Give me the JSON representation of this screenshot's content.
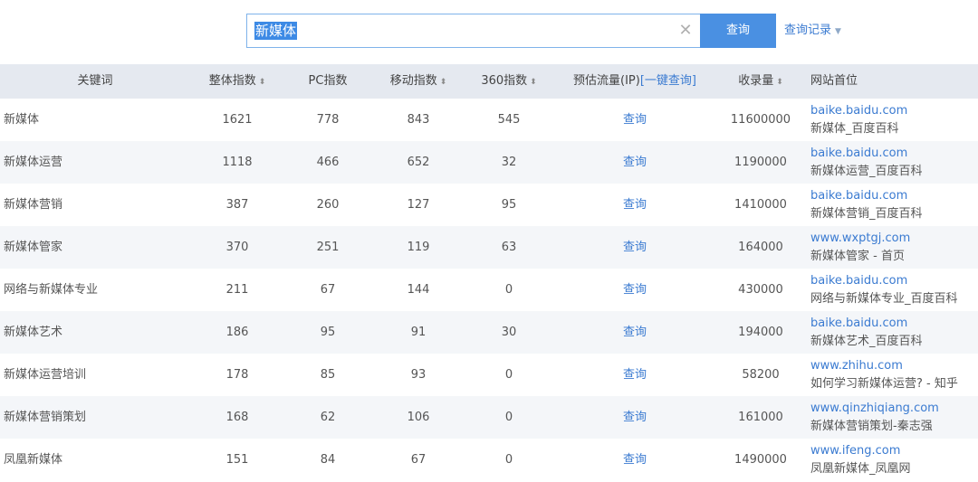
{
  "search": {
    "query": "新媒体",
    "button_label": "查询",
    "history_label": "查询记录"
  },
  "table": {
    "headers": {
      "keyword": "关键词",
      "total_index": "整体指数",
      "pc_index": "PC指数",
      "mobile_index": "移动指数",
      "index_360": "360指数",
      "est_flow": "预估流量(IP)",
      "one_click_query": "[一键查询]",
      "indexed_count": "收录量",
      "site_first": "网站首位"
    },
    "rows": [
      {
        "keyword": "新媒体",
        "total": "1621",
        "pc": "778",
        "mobile": "843",
        "i360": "545",
        "flow": "查询",
        "indexed": "11600000",
        "domain": "baike.baidu.com",
        "title": "新媒体_百度百科"
      },
      {
        "keyword": "新媒体运营",
        "total": "1118",
        "pc": "466",
        "mobile": "652",
        "i360": "32",
        "flow": "查询",
        "indexed": "1190000",
        "domain": "baike.baidu.com",
        "title": "新媒体运营_百度百科"
      },
      {
        "keyword": "新媒体营销",
        "total": "387",
        "pc": "260",
        "mobile": "127",
        "i360": "95",
        "flow": "查询",
        "indexed": "1410000",
        "domain": "baike.baidu.com",
        "title": "新媒体营销_百度百科"
      },
      {
        "keyword": "新媒体管家",
        "total": "370",
        "pc": "251",
        "mobile": "119",
        "i360": "63",
        "flow": "查询",
        "indexed": "164000",
        "domain": "www.wxptgj.com",
        "title": "新媒体管家 - 首页"
      },
      {
        "keyword": "网络与新媒体专业",
        "total": "211",
        "pc": "67",
        "mobile": "144",
        "i360": "0",
        "flow": "查询",
        "indexed": "430000",
        "domain": "baike.baidu.com",
        "title": "网络与新媒体专业_百度百科"
      },
      {
        "keyword": "新媒体艺术",
        "total": "186",
        "pc": "95",
        "mobile": "91",
        "i360": "30",
        "flow": "查询",
        "indexed": "194000",
        "domain": "baike.baidu.com",
        "title": "新媒体艺术_百度百科"
      },
      {
        "keyword": "新媒体运营培训",
        "total": "178",
        "pc": "85",
        "mobile": "93",
        "i360": "0",
        "flow": "查询",
        "indexed": "58200",
        "domain": "www.zhihu.com",
        "title": "如何学习新媒体运营? - 知乎"
      },
      {
        "keyword": "新媒体营销策划",
        "total": "168",
        "pc": "62",
        "mobile": "106",
        "i360": "0",
        "flow": "查询",
        "indexed": "161000",
        "domain": "www.qinzhiqiang.com",
        "title": "新媒体营销策划-秦志强"
      },
      {
        "keyword": "凤凰新媒体",
        "total": "151",
        "pc": "84",
        "mobile": "67",
        "i360": "0",
        "flow": "查询",
        "indexed": "1490000",
        "domain": "www.ifeng.com",
        "title": "凤凰新媒体_凤凰网"
      }
    ]
  },
  "icons": {
    "clear": "close-icon",
    "sort": "sort-icon",
    "dropdown": "chevron-down-icon"
  },
  "colors": {
    "accent": "#4a90e2",
    "link": "#3b7bd1",
    "header_bg": "#e5e9f0",
    "alt_row_bg": "#f4f6f9"
  }
}
